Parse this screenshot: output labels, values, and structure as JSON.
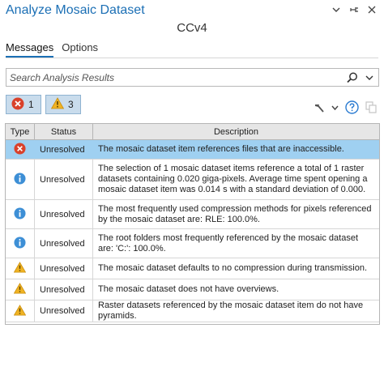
{
  "window": {
    "title": "Analyze Mosaic Dataset",
    "subtitle": "CCv4",
    "icons": [
      "chevron-down-icon",
      "pin-icon",
      "close-icon"
    ]
  },
  "tabs": [
    {
      "label": "Messages",
      "active": true
    },
    {
      "label": "Options",
      "active": false
    }
  ],
  "search": {
    "placeholder": "Search Analysis Results",
    "value": ""
  },
  "filters": {
    "errors": "1",
    "warnings": "3"
  },
  "toolbar": {
    "icons": [
      "hammer-icon",
      "chevron-down-icon",
      "help-icon",
      "copy-icon"
    ]
  },
  "table": {
    "columns": [
      "Type",
      "Status",
      "Description"
    ],
    "rows": [
      {
        "type": "error",
        "status": "Unresolved",
        "description": "The mosaic dataset item references files that are inaccessible.",
        "selected": true
      },
      {
        "type": "info",
        "status": "Unresolved",
        "description": "The selection of 1 mosaic dataset items reference a total of 1 raster datasets containing 0.020 giga-pixels. Average time spent opening a mosaic dataset item was 0.014 s with a standard deviation of 0.000.",
        "selected": false
      },
      {
        "type": "info",
        "status": "Unresolved",
        "description": "The most frequently used compression methods for pixels referenced by the mosaic dataset are: RLE: 100.0%.",
        "selected": false
      },
      {
        "type": "info",
        "status": "Unresolved",
        "description": "The root folders most frequently referenced by the mosaic dataset are: 'C:': 100.0%.",
        "selected": false
      },
      {
        "type": "warning",
        "status": "Unresolved",
        "description": "The mosaic dataset defaults to no compression during transmission.",
        "selected": false
      },
      {
        "type": "warning",
        "status": "Unresolved",
        "description": "The mosaic dataset does not have overviews.",
        "selected": false
      },
      {
        "type": "warning",
        "status": "Unresolved",
        "description": "Raster datasets referenced by the mosaic dataset item do not have pyramids.",
        "selected": false
      }
    ]
  },
  "colors": {
    "title": "#1b6fb5",
    "error": "#d9412b",
    "info": "#3d8fd6",
    "warning": "#f0b323",
    "selected_row": "#9fd0f1",
    "filter_button": "#c9dcec"
  }
}
